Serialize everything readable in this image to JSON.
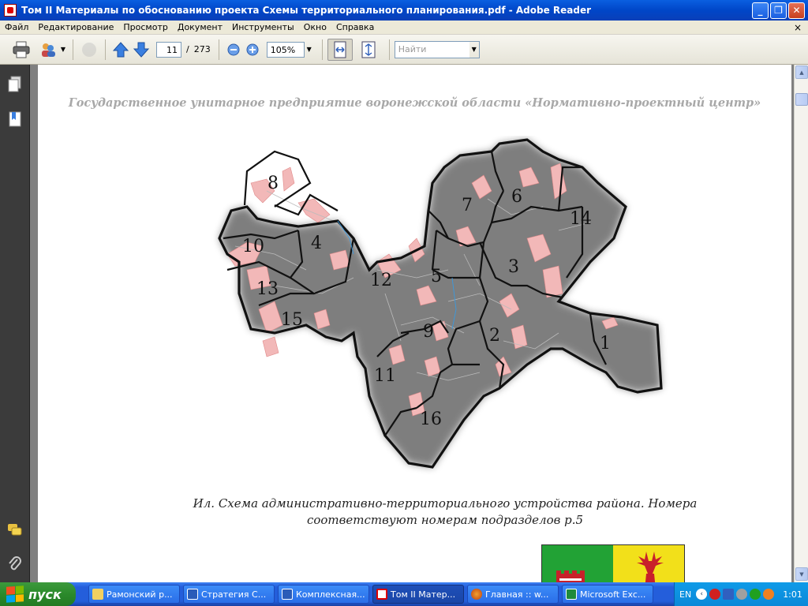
{
  "window": {
    "title": "Том II Материалы по обоснованию проекта Схемы территориального планирования.pdf - Adobe Reader"
  },
  "menu": {
    "items": [
      "Файл",
      "Редактирование",
      "Просмотр",
      "Документ",
      "Инструменты",
      "Окно",
      "Справка"
    ],
    "close_glyph": "×"
  },
  "toolbar": {
    "current_page": "11",
    "page_sep": "/",
    "total_pages": "273",
    "zoom": "105%",
    "find_placeholder": "Найти"
  },
  "document": {
    "header": "Государственное унитарное предприятие воронежской области «Нормативно-проектный центр»",
    "caption_line1": "Ил.  Схема административно-территориального устройства района. Номера",
    "caption_line2": "соответствуют номерам подразделов р.5",
    "map_labels": [
      "1",
      "2",
      "3",
      "4",
      "5",
      "6",
      "7",
      "8",
      "9",
      "10",
      "11",
      "12",
      "13",
      "14",
      "15",
      "16"
    ]
  },
  "taskbar": {
    "start_label": "пуск",
    "tasks": [
      {
        "label": "Рамонский р...",
        "icon": "folder-icon"
      },
      {
        "label": "Стратегия С...",
        "icon": "word-icon"
      },
      {
        "label": "Комплексная...",
        "icon": "word-icon"
      },
      {
        "label": "Том II Матер...",
        "icon": "pdf-icon"
      },
      {
        "label": "Главная :: w...",
        "icon": "firefox-icon"
      },
      {
        "label": "Microsoft Exc...",
        "icon": "excel-icon"
      }
    ],
    "language": "EN",
    "clock": "1:01"
  },
  "colors": {
    "titlebar": "#0a5fe0",
    "taskbar": "#245edb",
    "start": "#2b8a2b",
    "settlement": "#f2b8b8",
    "boundary": "#111111"
  }
}
